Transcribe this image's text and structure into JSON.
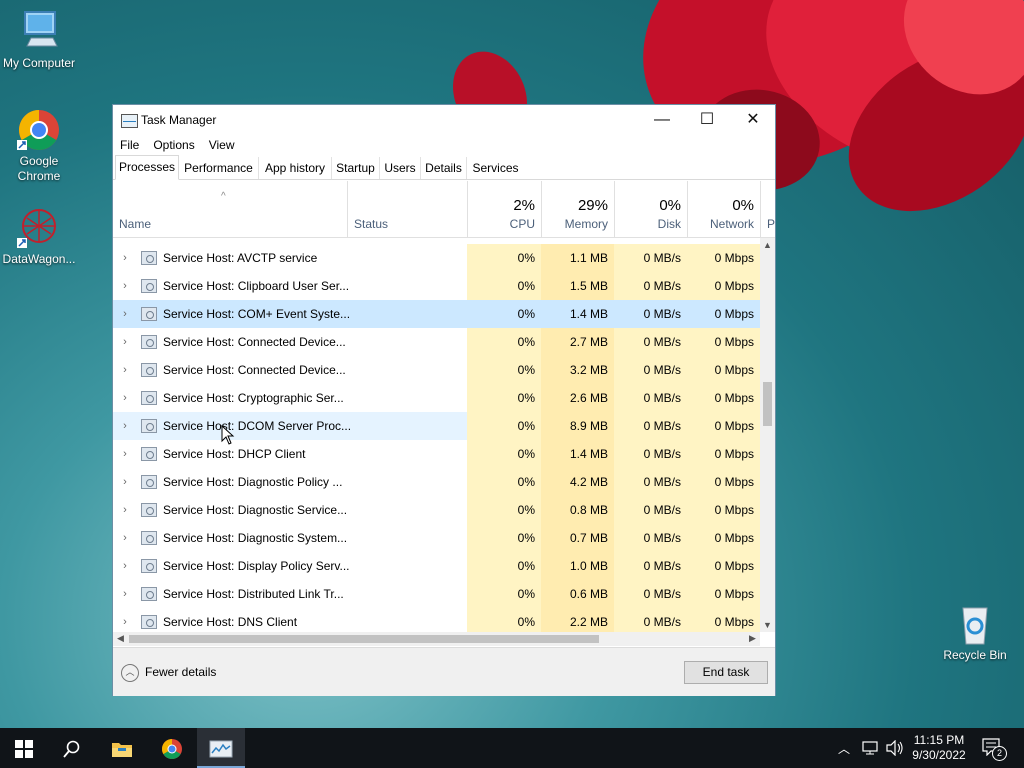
{
  "desktop": {
    "icons": [
      {
        "label": "My Computer",
        "icon": "computer-icon"
      },
      {
        "label": "Google Chrome",
        "icon": "chrome-icon"
      },
      {
        "label": "DataWagon...",
        "icon": "datawagon-icon"
      },
      {
        "label": "Recycle Bin",
        "icon": "recycle-bin-icon"
      }
    ]
  },
  "window": {
    "title": "Task Manager",
    "controls": {
      "minimize": "—",
      "maximize": "☐",
      "close": "✕"
    },
    "menu": [
      "File",
      "Options",
      "View"
    ],
    "tabs": [
      "Processes",
      "Performance",
      "App history",
      "Startup",
      "Users",
      "Details",
      "Services"
    ],
    "active_tab": "Processes",
    "columns": {
      "name": "Name",
      "status": "Status",
      "cpu": {
        "label": "CPU",
        "pct": "2%"
      },
      "memory": {
        "label": "Memory",
        "pct": "29%"
      },
      "disk": {
        "label": "Disk",
        "pct": "0%"
      },
      "network": {
        "label": "Network",
        "pct": "0%"
      },
      "power": "P"
    },
    "processes": [
      {
        "name": "Service Host: AVCTP service",
        "cpu": "0%",
        "memory": "1.1 MB",
        "disk": "0 MB/s",
        "network": "0 Mbps"
      },
      {
        "name": "Service Host: Clipboard User Ser...",
        "cpu": "0%",
        "memory": "1.5 MB",
        "disk": "0 MB/s",
        "network": "0 Mbps"
      },
      {
        "name": "Service Host: COM+ Event Syste...",
        "cpu": "0%",
        "memory": "1.4 MB",
        "disk": "0 MB/s",
        "network": "0 Mbps"
      },
      {
        "name": "Service Host: Connected Device...",
        "cpu": "0%",
        "memory": "2.7 MB",
        "disk": "0 MB/s",
        "network": "0 Mbps"
      },
      {
        "name": "Service Host: Connected Device...",
        "cpu": "0%",
        "memory": "3.2 MB",
        "disk": "0 MB/s",
        "network": "0 Mbps"
      },
      {
        "name": "Service Host: Cryptographic Ser...",
        "cpu": "0%",
        "memory": "2.6 MB",
        "disk": "0 MB/s",
        "network": "0 Mbps"
      },
      {
        "name": "Service Host: DCOM Server Proc...",
        "cpu": "0%",
        "memory": "8.9 MB",
        "disk": "0 MB/s",
        "network": "0 Mbps"
      },
      {
        "name": "Service Host: DHCP Client",
        "cpu": "0%",
        "memory": "1.4 MB",
        "disk": "0 MB/s",
        "network": "0 Mbps"
      },
      {
        "name": "Service Host: Diagnostic Policy ...",
        "cpu": "0%",
        "memory": "4.2 MB",
        "disk": "0 MB/s",
        "network": "0 Mbps"
      },
      {
        "name": "Service Host: Diagnostic Service...",
        "cpu": "0%",
        "memory": "0.8 MB",
        "disk": "0 MB/s",
        "network": "0 Mbps"
      },
      {
        "name": "Service Host: Diagnostic System...",
        "cpu": "0%",
        "memory": "0.7 MB",
        "disk": "0 MB/s",
        "network": "0 Mbps"
      },
      {
        "name": "Service Host: Display Policy Serv...",
        "cpu": "0%",
        "memory": "1.0 MB",
        "disk": "0 MB/s",
        "network": "0 Mbps"
      },
      {
        "name": "Service Host: Distributed Link Tr...",
        "cpu": "0%",
        "memory": "0.6 MB",
        "disk": "0 MB/s",
        "network": "0 Mbps"
      },
      {
        "name": "Service Host: DNS Client",
        "cpu": "0%",
        "memory": "2.2 MB",
        "disk": "0 MB/s",
        "network": "0 Mbps"
      }
    ],
    "selected_row": 2,
    "hover_row": 6,
    "footer": {
      "fewer_details": "Fewer details",
      "end_task": "End task"
    }
  },
  "taskbar": {
    "time": "11:15 PM",
    "date": "9/30/2022",
    "notifications": "2"
  },
  "colors": {
    "selected_row": "#cce8ff",
    "hover_row": "#e5f3ff",
    "heat_light": "#fff4c4",
    "heat_memory": "#ffecb0"
  }
}
